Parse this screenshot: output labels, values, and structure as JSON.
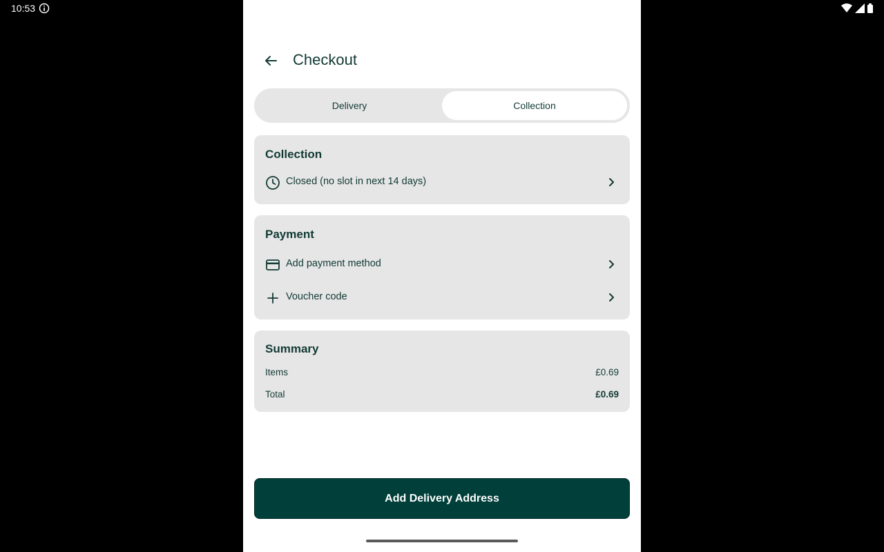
{
  "status_bar": {
    "time": "10:53"
  },
  "header": {
    "title": "Checkout"
  },
  "tabs": [
    {
      "label": "Delivery",
      "active": false
    },
    {
      "label": "Collection",
      "active": true
    }
  ],
  "collection": {
    "title": "Collection",
    "slot_label": "Closed (no slot in next 14 days)"
  },
  "payment": {
    "title": "Payment",
    "method_label": "Add payment method",
    "voucher_label": "Voucher code"
  },
  "summary": {
    "title": "Summary",
    "items_label": "Items",
    "items_value": "£0.69",
    "total_label": "Total",
    "total_value": "£0.69"
  },
  "cta": {
    "label": "Add Delivery Address"
  },
  "colors": {
    "accent": "#013f3a",
    "card_bg": "#e6e6e6",
    "text": "#123a33"
  }
}
